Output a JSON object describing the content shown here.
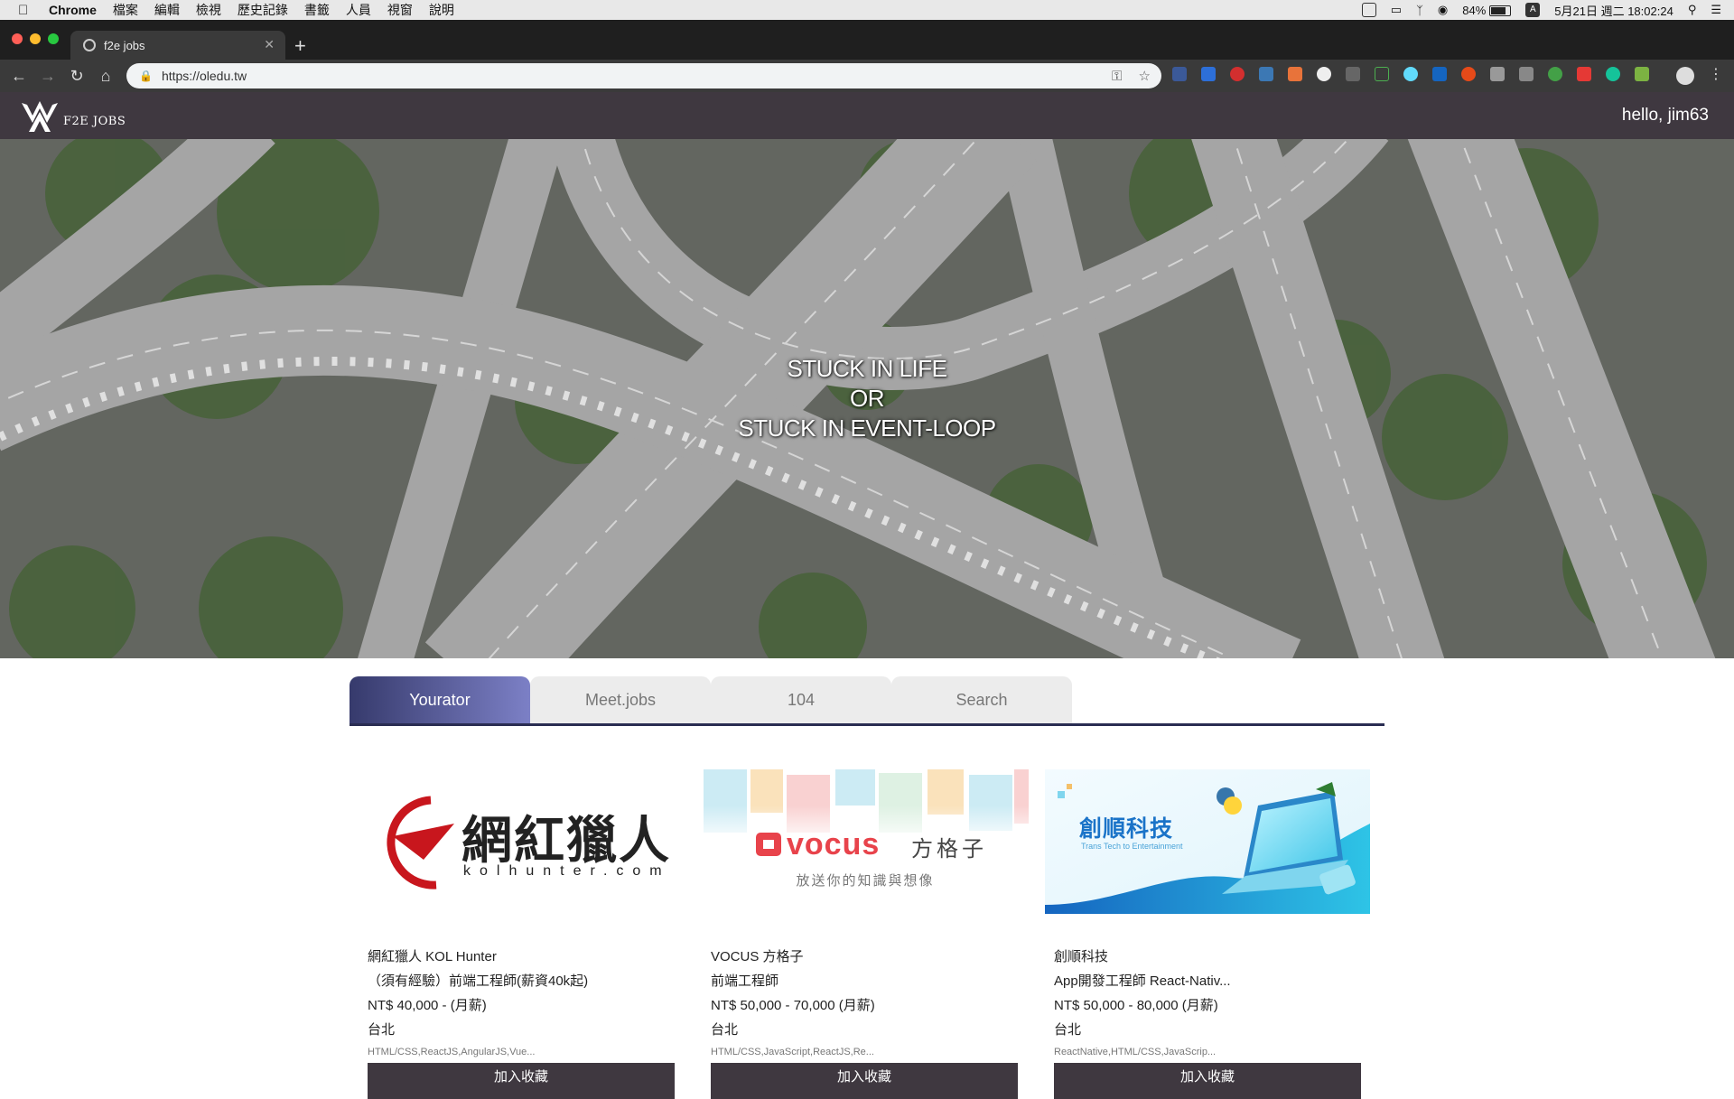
{
  "os_menubar": {
    "app_name": "Chrome",
    "menus": [
      "檔案",
      "編輯",
      "檢視",
      "歷史記錄",
      "書籤",
      "人員",
      "視窗",
      "說明"
    ],
    "battery": "84%",
    "input_method": "A",
    "clock": "5月21日 週二  18:02:24"
  },
  "browser": {
    "tab_title": "f2e jobs",
    "url": "https://oledu.tw"
  },
  "site": {
    "logo_text": "F2E JOBS",
    "greeting": "hello, jim63"
  },
  "hero": {
    "line1": "STUCK IN LIFE",
    "line2": "OR",
    "line3": "STUCK IN EVENT-LOOP"
  },
  "tabs": [
    "Yourator",
    "Meet.jobs",
    "104",
    "Search"
  ],
  "jobs": [
    {
      "company": "網紅獵人 KOL Hunter",
      "title": "（須有經驗）前端工程師(薪資40k起)",
      "salary": "NT$ 40,000 - (月薪)",
      "location": "台北",
      "tags": "HTML/CSS,ReactJS,AngularJS,Vue...",
      "button": "加入收藏",
      "logo_main": "網紅獵人",
      "logo_sub": "kolhunter.com"
    },
    {
      "company": "VOCUS 方格子",
      "title": "前端工程師",
      "salary": "NT$ 50,000 - 70,000 (月薪)",
      "location": "台北",
      "tags": "HTML/CSS,JavaScript,ReactJS,Re...",
      "button": "加入收藏",
      "logo_main": "vocus",
      "logo_cn": "方格子",
      "logo_sub": "放送你的知識與想像"
    },
    {
      "company": "創順科技",
      "title": "App開發工程師 React-Nativ...",
      "salary": "NT$ 50,000 - 80,000 (月薪)",
      "location": "台北",
      "tags": "ReactNative,HTML/CSS,JavaScrip...",
      "button": "加入收藏",
      "logo_main": "創順科技",
      "logo_sub": "Trans Tech to Entertainment"
    }
  ],
  "colors": {
    "header_bg": "#3f3840",
    "tab_active_from": "#363a6c",
    "tab_active_to": "#7c80c6",
    "kol_red": "#c8161d",
    "vocus_red": "#e8434b",
    "tech_blue": "#1a73c8"
  }
}
